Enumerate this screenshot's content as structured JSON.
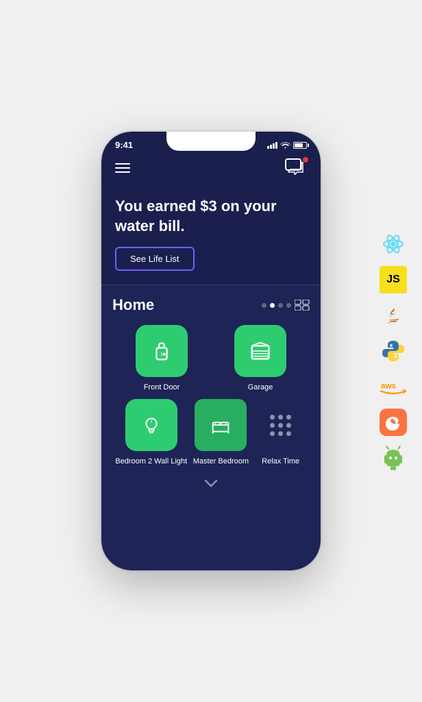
{
  "status_bar": {
    "time": "9:41"
  },
  "header": {
    "menu_label": "Menu",
    "message_label": "Messages"
  },
  "hero": {
    "title": "You earned $3 on your water bill.",
    "cta_label": "See Life List"
  },
  "home_section": {
    "title": "Home",
    "pagination": {
      "dots": [
        false,
        true,
        false,
        false
      ]
    },
    "devices": [
      {
        "id": "front-door",
        "label": "Front Door",
        "icon": "lock",
        "style": "green",
        "col_span": 1
      },
      {
        "id": "garage",
        "label": "Garage",
        "icon": "garage",
        "style": "green",
        "col_span": 1
      },
      {
        "id": "bedroom2-light",
        "label": "Bedroom 2 Wall Light",
        "icon": "bulb",
        "style": "green"
      },
      {
        "id": "master-bedroom",
        "label": "Master Bedroom",
        "icon": "bed",
        "style": "green-square"
      },
      {
        "id": "relax-time",
        "label": "Relax Time",
        "icon": "dots",
        "style": "dots"
      }
    ]
  },
  "tech_icons": [
    {
      "id": "react",
      "label": "React"
    },
    {
      "id": "javascript",
      "label": "JavaScript"
    },
    {
      "id": "java",
      "label": "Java"
    },
    {
      "id": "python",
      "label": "Python"
    },
    {
      "id": "aws",
      "label": "AWS"
    },
    {
      "id": "swift",
      "label": "Swift"
    },
    {
      "id": "android",
      "label": "Android"
    }
  ]
}
